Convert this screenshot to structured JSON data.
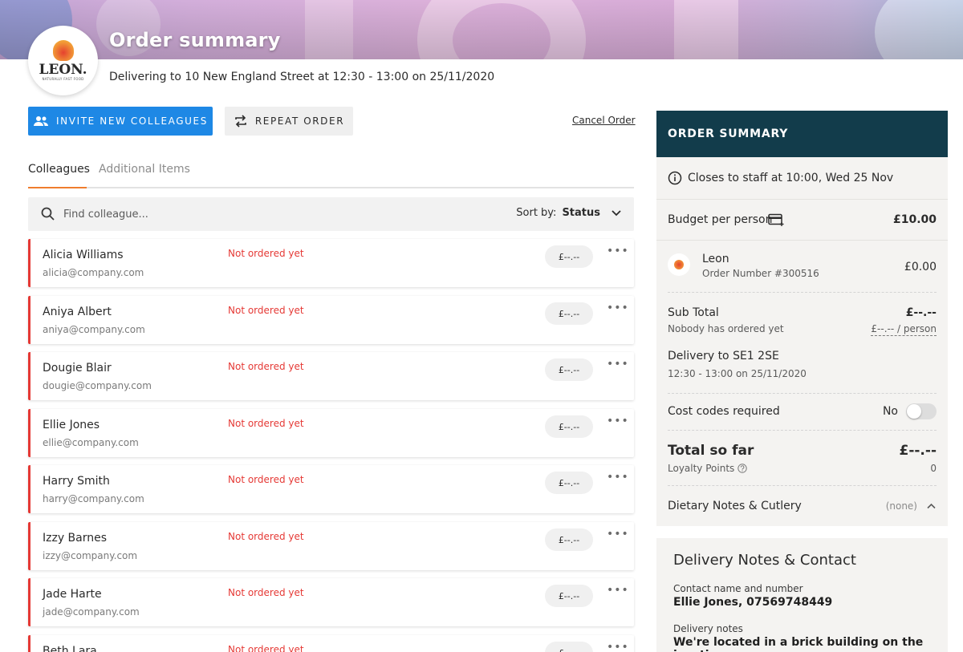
{
  "header": {
    "title": "Order summary",
    "delivering": "Delivering to 10 New England Street at 12:30 - 13:00 on 25/11/2020",
    "logo_text": "LEON.",
    "logo_tagline": "NATURALLY FAST FOOD"
  },
  "actions": {
    "invite_label": "INVITE NEW COLLEAGUES",
    "repeat_label": "REPEAT ORDER",
    "cancel_label": "Cancel Order"
  },
  "tabs": [
    {
      "label": "Colleagues",
      "active": true
    },
    {
      "label": "Additional Items",
      "active": false
    }
  ],
  "search": {
    "placeholder": "Find colleague...",
    "sort_label": "Sort by:",
    "sort_value": "Status"
  },
  "colleagues": [
    {
      "name": "Alicia Williams",
      "email": "alicia@company.com",
      "status": "Not ordered yet",
      "price": "£--.--"
    },
    {
      "name": "Aniya Albert",
      "email": "aniya@company.com",
      "status": "Not ordered yet",
      "price": "£--.--"
    },
    {
      "name": "Dougie Blair",
      "email": "dougie@company.com",
      "status": "Not ordered yet",
      "price": "£--.--"
    },
    {
      "name": "Ellie Jones",
      "email": "ellie@company.com",
      "status": "Not ordered yet",
      "price": "£--.--"
    },
    {
      "name": "Harry Smith",
      "email": "harry@company.com",
      "status": "Not ordered yet",
      "price": "£--.--"
    },
    {
      "name": "Izzy Barnes",
      "email": "izzy@company.com",
      "status": "Not ordered yet",
      "price": "£--.--"
    },
    {
      "name": "Jade Harte",
      "email": "jade@company.com",
      "status": "Not ordered yet",
      "price": "£--.--"
    },
    {
      "name": "Beth Lara",
      "email": "",
      "status": "Not ordered yet",
      "price": "£--.--"
    }
  ],
  "summary": {
    "title": "ORDER SUMMARY",
    "closes": "Closes to staff at 10:00, Wed 25 Nov",
    "budget_label": "Budget per person",
    "budget_value": "£10.00",
    "restaurant_name": "Leon",
    "order_number": "Order Number #300516",
    "restaurant_value": "£0.00",
    "subtotal_label": "Sub Total",
    "subtotal_value": "£--.--",
    "subtotal_note": "Nobody has ordered yet",
    "per_person": "£--.-- / person",
    "delivery_label": "Delivery to SE1 2SE",
    "delivery_time": "12:30 - 13:00 on 25/11/2020",
    "cost_codes_label": "Cost codes required",
    "cost_codes_value": "No",
    "total_label": "Total so far",
    "total_value": "£--.--",
    "loyalty_label": "Loyalty Points",
    "loyalty_value": "0",
    "dietary_label": "Dietary Notes & Cutlery",
    "dietary_value": "(none)"
  },
  "delivery_notes": {
    "title": "Delivery Notes & Contact",
    "contact_label": "Contact name and number",
    "contact_value": "Ellie Jones, 07569748449",
    "notes_label": "Delivery notes",
    "notes_value": "We're located in a brick building on the junction"
  },
  "colors": {
    "accent_blue": "#1e88e5",
    "header_dark": "#123c4b",
    "status_red": "#e53935",
    "tab_orange": "#ef7d2d"
  }
}
